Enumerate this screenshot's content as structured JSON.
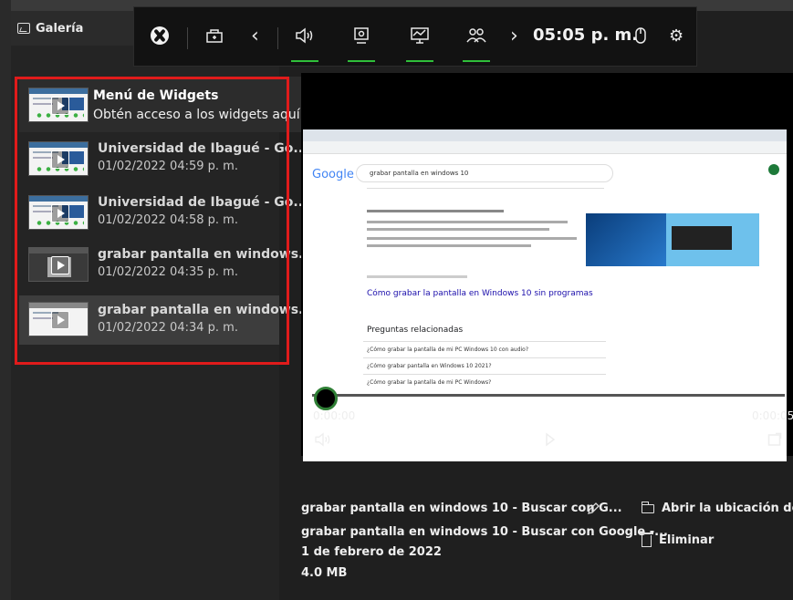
{
  "gallery": {
    "title": "Galería"
  },
  "gamebar": {
    "icons": {
      "xbox": "xbox-icon",
      "widget_store": "widget-store-icon",
      "prev": "‹",
      "audio": "🔊",
      "capture": "capture-icon",
      "performance": "performance-icon",
      "social": "social-icon",
      "next": "›",
      "mouse": "mouse-icon",
      "settings": "⚙"
    },
    "time": "05:05 p. m."
  },
  "widget_menu": {
    "title": "Menú de Widgets",
    "subtitle": "Obtén acceso a los widgets aquí"
  },
  "captures": [
    {
      "title": "Universidad de Ibagué - Go...",
      "date": "01/02/2022 04:59 p. m."
    },
    {
      "title": "Universidad de Ibagué - Go...",
      "date": "01/02/2022 04:58 p. m."
    },
    {
      "title": "grabar pantalla en windows...",
      "date": "01/02/2022 04:35 p. m."
    },
    {
      "title": "grabar pantalla en windows...",
      "date": "01/02/2022 04:34 p. m."
    }
  ],
  "player": {
    "time_start": "0:00:00",
    "time_end": "0:00:05",
    "screen": {
      "google": "Google",
      "query": "grabar pantalla en windows 10",
      "result_link": "Cómo grabar la pantalla en Windows 10 sin programas",
      "related_title": "Preguntas relacionadas",
      "related": [
        "¿Cómo grabar la pantalla de mi PC Windows 10 con audio?",
        "¿Cómo grabar pantalla en Windows 10 2021?",
        "¿Cómo grabar la pantalla de mi PC Windows?"
      ]
    }
  },
  "details": {
    "title_short": "grabar pantalla en windows 10 - Buscar con G...",
    "title_full": "grabar pantalla en windows 10 - Buscar con Google -...",
    "date": "1 de febrero de 2022",
    "size": "4.0 MB",
    "open_location": "Abrir la ubicación de...",
    "delete": "Eliminar"
  }
}
